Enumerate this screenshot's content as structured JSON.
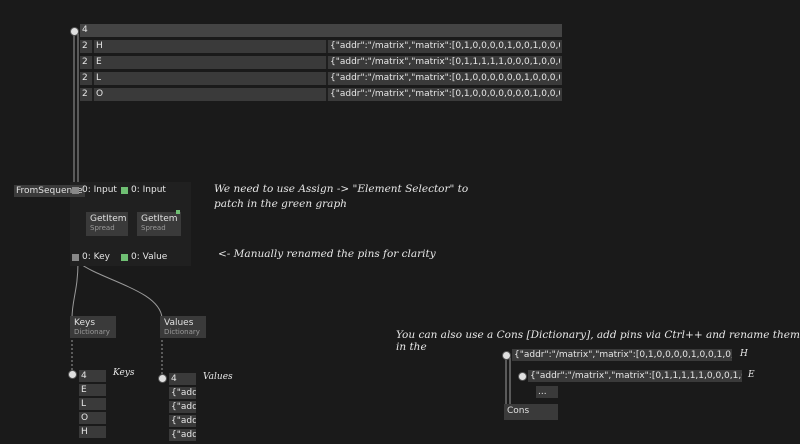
{
  "sheet": {
    "count": "4",
    "rows": [
      {
        "count": "2",
        "key": "H",
        "value": "{\"addr\":\"/matrix\",\"matrix\":[0,1,0,0,0,0,1,0,0,1,0,0,0,0,1,0,0,1,"
      },
      {
        "count": "2",
        "key": "E",
        "value": "{\"addr\":\"/matrix\",\"matrix\":[0,1,1,1,1,1,0,0,0,1,0,0,0,0,0,0,1,"
      },
      {
        "count": "2",
        "key": "L",
        "value": "{\"addr\":\"/matrix\",\"matrix\":[0,1,0,0,0,0,0,0,1,0,0,0,0,0,0,0,1,"
      },
      {
        "count": "2",
        "key": "O",
        "value": "{\"addr\":\"/matrix\",\"matrix\":[0,1,0,0,0,0,0,0,0,1,0,0,0,0,0,0,1,"
      }
    ]
  },
  "patch": {
    "from_sequence": "FromSequence",
    "in_key": "0: Input",
    "in_val": "0: Input",
    "getitem1": "GetItem",
    "getitem1_sub": "Spread",
    "getitem2": "GetItem",
    "getitem2_sub": "Spread",
    "out_key": "0: Key",
    "out_val": "0: Value"
  },
  "notes": {
    "assign": "We need to use Assign -> \"Element Selector\" to",
    "assign2": "patch in the green graph",
    "renamed": "<- Manually renamed the pins for clarity",
    "cons": "You can also use a Cons [Dictionary], add pins via Ctrl++ and rename them in the"
  },
  "keys_node": {
    "title": "Keys",
    "sub": "Dictionary"
  },
  "values_node": {
    "title": "Values",
    "sub": "Dictionary"
  },
  "keys_list": {
    "label": "Keys",
    "items": [
      "4",
      "E",
      "L",
      "O",
      "H"
    ]
  },
  "values_list": {
    "label": "Values",
    "items": [
      "4",
      "{\"addr",
      "{\"addr",
      "{\"addr",
      "{\"addr"
    ]
  },
  "cons": {
    "h_value": "{\"addr\":\"/matrix\",\"matrix\":[0,1,0,0,0,0,1,0,0,1,0,0,0,0,1,0,",
    "h_label": "H",
    "e_value": "{\"addr\":\"/matrix\",\"matrix\":[0,1,1,1,1,1,0,0,0,1,0,0,0,0,0,0,",
    "e_label": "E",
    "more": "...",
    "node": "Cons"
  }
}
